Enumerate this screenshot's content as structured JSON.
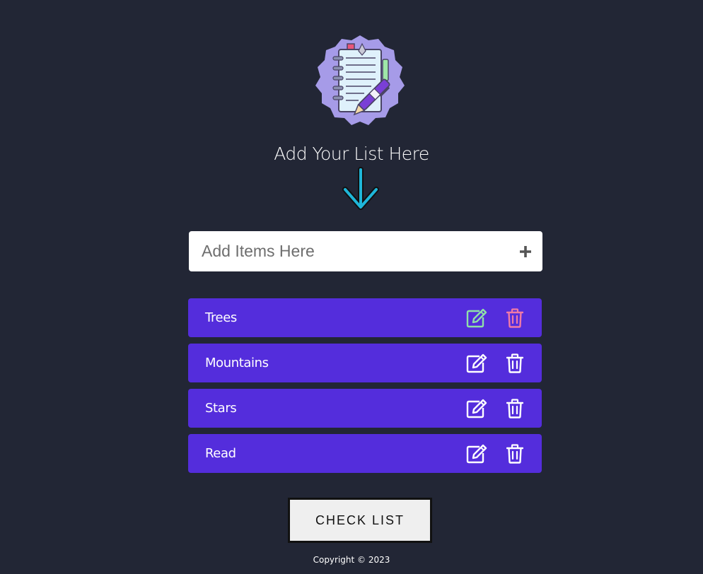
{
  "header": {
    "logo_icon": "notebook-with-pen-icon",
    "title": "Add Your List Here",
    "arrow_icon": "arrow-down-icon"
  },
  "add_item": {
    "placeholder": "Add Items Here",
    "value": "",
    "add_icon": "plus-icon"
  },
  "items": [
    {
      "label": "Trees",
      "highlighted": true
    },
    {
      "label": "Mountains",
      "highlighted": false
    },
    {
      "label": "Stars",
      "highlighted": false
    },
    {
      "label": "Read",
      "highlighted": false
    }
  ],
  "item_actions": {
    "edit_icon": "edit-icon",
    "delete_icon": "trash-icon"
  },
  "check_button_label": "CHECK LIST",
  "footer": {
    "copyright": "Copyright © 2023"
  },
  "colors": {
    "background": "#222635",
    "item_background": "#542ddc",
    "edit_highlight": "#8fe0a8",
    "delete_highlight": "#f07aa6",
    "arrow": "#1fb6d9",
    "logo_badge": "#a69be8"
  }
}
